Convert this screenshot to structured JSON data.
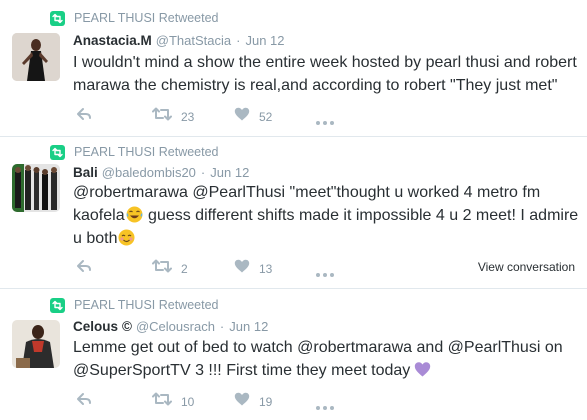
{
  "tweets": [
    {
      "retweeted_by": "PEARL THUSI Retweeted",
      "name": "Anastacia.M",
      "handle": "@ThatStacia",
      "separator": "·",
      "time": "Jun 12",
      "text": "I wouldn't mind a show the entire week hosted by pearl thusi and robert marawa the chemistry is real,and according to robert \"They just met\"",
      "retweets": "23",
      "likes": "52"
    },
    {
      "retweeted_by": "PEARL THUSI Retweeted",
      "name": "Bali",
      "handle": "@baledombis20",
      "separator": "·",
      "time": "Jun 12",
      "text_part1": "@robertmarawa @PearlThusi \"meet\"thought u worked 4 metro fm kaofela",
      "text_part2": " guess different shifts made it impossible 4 u 2 meet! I admire u both",
      "retweets": "2",
      "likes": "13",
      "view_conversation": "View conversation"
    },
    {
      "retweeted_by": "PEARL THUSI Retweeted",
      "name": "Celous",
      "name_badge": "©",
      "handle": "@Celousrach",
      "separator": "·",
      "time": "Jun 12",
      "text": "Lemme get out of bed to watch @robertmarawa and @PearlThusi  on @SuperSportTV 3 !!!  First time they meet today",
      "retweets": "10",
      "likes": "19"
    }
  ],
  "icons": {
    "retweeted": "retweet-icon",
    "reply": "reply-icon",
    "retweet": "retweet-icon",
    "like": "heart-icon",
    "more": "more-icon",
    "emoji_1": "tears-of-joy-emoji",
    "emoji_2": "smiling-face-emoji",
    "emoji_3": "purple-heart-emoji"
  },
  "colors": {
    "retweet_badge": "#19cf86",
    "muted": "#8899a6",
    "icon": "#aab8c2",
    "text": "#292f33",
    "divider": "#e1e8ed"
  }
}
